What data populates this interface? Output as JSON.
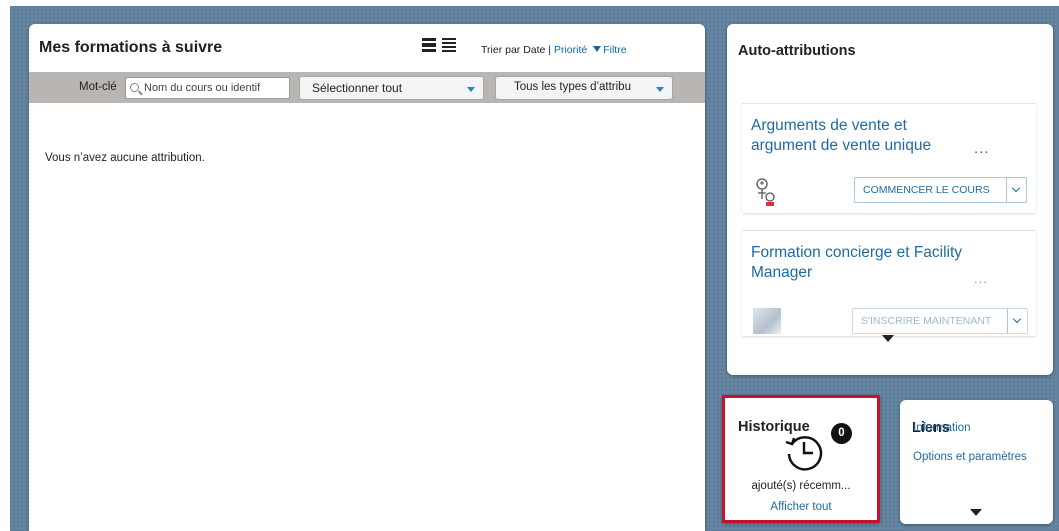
{
  "main": {
    "title": "Mes formations à suivre",
    "sort_prefix": "Trier par Date | ",
    "sort_priority": "Priorité",
    "filter": "Filtre",
    "keyword_label": "Mot-clé",
    "search_placeholder": "Nom du cours ou identif",
    "select_all": "Sélectionner tout",
    "types_select": "Tous les types d’attribu",
    "empty_message": "Vous n’avez aucune attribution.",
    "icons": [
      "list-detailed-icon",
      "list-compact-icon",
      "funnel-icon",
      "search-icon"
    ]
  },
  "auto": {
    "title": "Auto-attributions",
    "cards": [
      {
        "title": "Arguments de vente et argument de vente unique",
        "ellipsis": "...",
        "button": "COMMENCER LE COURS",
        "icon": "course-type-icon"
      },
      {
        "title": "Formation concierge et Facility Manager",
        "ellipsis": "...",
        "button": "S'INSCRIRE MAINTENANT",
        "icon": "course-thumbnail"
      }
    ]
  },
  "history": {
    "title": "Historique",
    "count": "0",
    "subtitle": "ajouté(s) récemm...",
    "link": "Afficher tout",
    "icon": "history-clock-icon"
  },
  "links": {
    "title": "Liens",
    "items": [
      "Information",
      "Options et paramètres"
    ]
  },
  "colors": {
    "background": "#5f7f9c",
    "link": "#1f6aa5",
    "highlight_border": "#c8102e",
    "toolbar": "#b8b5b2"
  }
}
